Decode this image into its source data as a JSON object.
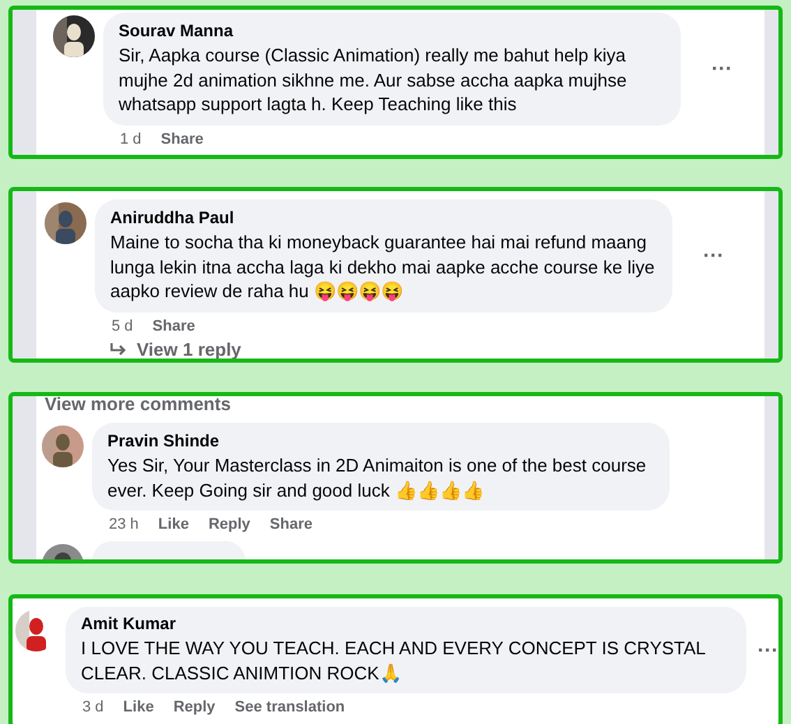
{
  "panels": [
    {
      "comments": [
        {
          "kind": "full",
          "name": "Sourav Manna",
          "text": "Sir, Aapka course (Classic Animation) really me bahut help kiya mujhe 2d animation sikhne me. Aur sabse accha aapka mujhse whatsapp support lagta h. Keep Teaching like this",
          "time": "1 d",
          "actions": [
            "Share"
          ],
          "more": "···"
        }
      ]
    },
    {
      "comments": [
        {
          "kind": "full",
          "name": "Aniruddha Paul",
          "text": "Maine to socha tha ki moneyback guarantee hai mai refund maang lunga lekin itna accha laga ki dekho mai aapke acche course ke liye aapko review de raha hu 😝😝😝😝",
          "time": "5 d",
          "actions": [
            "Share"
          ],
          "more": "···",
          "replies": "View 1 reply"
        }
      ]
    },
    {
      "more_comments": "View more comments",
      "comments": [
        {
          "kind": "full",
          "name": "Pravin Shinde",
          "text": "Yes Sir, Your Masterclass in 2D Animaiton is one of the best course ever. Keep Going sir and good luck 👍👍👍👍",
          "time": "23 h",
          "actions": [
            "Like",
            "Reply",
            "Share"
          ]
        },
        {
          "kind": "partial"
        }
      ]
    },
    {
      "comments": [
        {
          "kind": "full",
          "name": "Amit Kumar",
          "text": "I LOVE THE WAY YOU TEACH. EACH AND EVERY CONCEPT IS CRYSTAL CLEAR. CLASSIC ANIMTION ROCK🙏",
          "time": "3 d",
          "actions": [
            "Like",
            "Reply",
            "See translation"
          ],
          "more": "···"
        }
      ]
    }
  ]
}
